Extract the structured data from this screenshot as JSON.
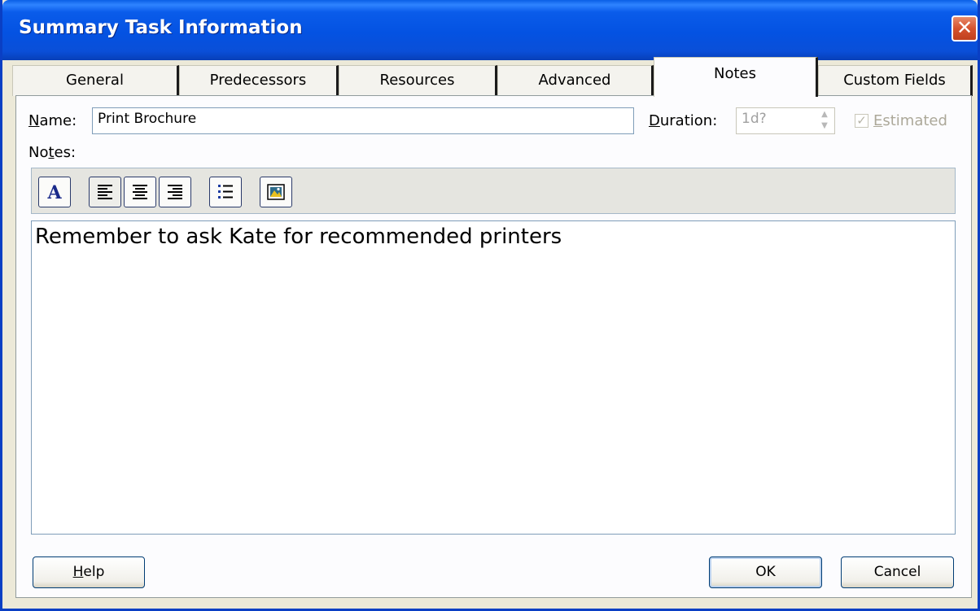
{
  "window": {
    "title": "Summary Task Information",
    "close_glyph": "✕"
  },
  "tabs": [
    {
      "label": "General"
    },
    {
      "label": "Predecessors"
    },
    {
      "label": "Resources"
    },
    {
      "label": "Advanced"
    },
    {
      "label": "Notes",
      "active": true
    },
    {
      "label": "Custom Fields"
    }
  ],
  "form": {
    "name_label_u": "N",
    "name_label_rest": "ame:",
    "name_value": "Print Brochure",
    "duration_label_u": "D",
    "duration_label_rest": "uration:",
    "duration_value": "1d?",
    "estimated_u": "E",
    "estimated_rest": "stimated",
    "estimated_checked": true,
    "notes_label_pre": "No",
    "notes_label_u": "t",
    "notes_label_post": "es:"
  },
  "toolbar": {
    "icons": [
      "font-icon",
      "align-left-icon",
      "align-center-icon",
      "align-right-icon",
      "bullets-icon",
      "insert-object-icon"
    ]
  },
  "notes": {
    "text": "Remember to ask Kate for recommended printers"
  },
  "buttons": {
    "help_u": "H",
    "help_rest": "elp",
    "ok": "OK",
    "cancel": "Cancel"
  },
  "colors": {
    "titlebar": "#0a5cea",
    "dialog_bg": "#ece9d8",
    "close": "#d5522e"
  }
}
